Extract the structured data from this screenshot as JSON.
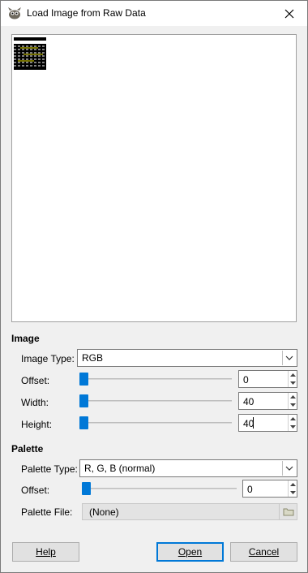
{
  "window": {
    "title": "Load Image from Raw Data"
  },
  "image_section": {
    "heading": "Image",
    "image_type": {
      "label": "Image Type:",
      "value": "RGB"
    },
    "offset": {
      "label": "Offset:",
      "value": "0"
    },
    "width": {
      "label": "Width:",
      "value": "40"
    },
    "height": {
      "label": "Height:",
      "value": "40"
    }
  },
  "palette_section": {
    "heading": "Palette",
    "palette_type": {
      "label": "Palette Type:",
      "value": "R, G, B (normal)"
    },
    "offset": {
      "label": "Offset:",
      "value": "0"
    },
    "palette_file": {
      "label": "Palette File:",
      "value": "(None)"
    }
  },
  "buttons": {
    "help": "Help",
    "open": "Open",
    "cancel": "Cancel"
  },
  "colors": {
    "accent": "#0078d7",
    "window_bg": "#f0f0f0"
  }
}
